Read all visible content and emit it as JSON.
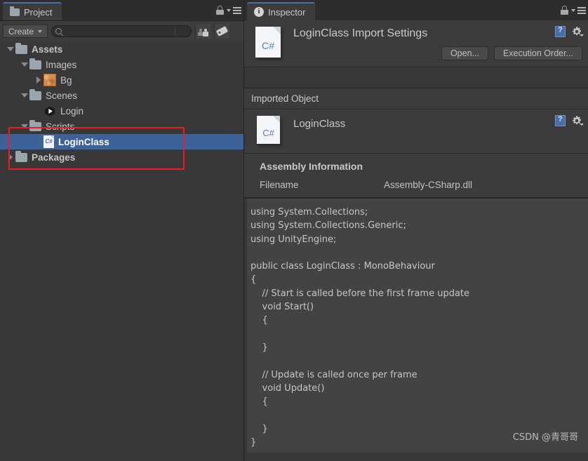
{
  "project_panel": {
    "tab": {
      "label": "Project",
      "icon": "folder-icon"
    },
    "tabbar_icons": {
      "lock": "lock-icon",
      "menu": "hamburger-menu-icon"
    },
    "toolbar": {
      "create_label": "Create",
      "search_value": "",
      "search_placeholder": "",
      "favorites_icon": "people-icon",
      "labels_icon": "label-tag-icon"
    },
    "tree": [
      {
        "label": "Assets",
        "indent": 0,
        "twisty": "down",
        "icon": "folder-icon",
        "bold": true,
        "selected": false
      },
      {
        "label": "Images",
        "indent": 1,
        "twisty": "down",
        "icon": "folder-icon",
        "bold": false,
        "selected": false
      },
      {
        "label": "Bg",
        "indent": 2,
        "twisty": "right",
        "icon": "texture-icon",
        "bold": false,
        "selected": false
      },
      {
        "label": "Scenes",
        "indent": 1,
        "twisty": "down",
        "icon": "folder-icon",
        "bold": false,
        "selected": false
      },
      {
        "label": "Login",
        "indent": 2,
        "twisty": "none",
        "icon": "unity-scene-icon",
        "bold": false,
        "selected": false
      },
      {
        "label": "Scripts",
        "indent": 1,
        "twisty": "down",
        "icon": "folder-icon",
        "bold": false,
        "selected": false
      },
      {
        "label": "LoginClass",
        "indent": 2,
        "twisty": "none",
        "icon": "csharp-file-icon",
        "bold": true,
        "selected": true
      },
      {
        "label": "Packages",
        "indent": 0,
        "twisty": "right",
        "icon": "folder-icon",
        "bold": true,
        "selected": false
      }
    ],
    "highlight_color": "#ed1c24",
    "selection_color": "#3d6199"
  },
  "inspector_panel": {
    "tab": {
      "label": "Inspector",
      "icon": "info-icon"
    },
    "tabbar_icons": {
      "lock": "lock-icon",
      "menu": "hamburger-menu-icon"
    },
    "import_header": {
      "title": "LoginClass Import Settings",
      "file_icon_label": "C#",
      "help_icon": "help-book-icon",
      "gear_icon": "gear-icon",
      "buttons": [
        {
          "label": "Open..."
        },
        {
          "label": "Execution Order..."
        }
      ]
    },
    "imported_object_section": {
      "header": "Imported Object",
      "object_name": "LoginClass",
      "file_icon_label": "C#",
      "help_icon": "help-book-icon",
      "gear_icon": "gear-icon"
    },
    "assembly_information": {
      "title": "Assembly Information",
      "rows": [
        {
          "key": "Filename",
          "value": "Assembly-CSharp.dll"
        }
      ]
    },
    "code_preview": "using System.Collections;\nusing System.Collections.Generic;\nusing UnityEngine;\n\npublic class LoginClass : MonoBehaviour\n{\n    // Start is called before the first frame update\n    void Start()\n    {\n        \n    }\n\n    // Update is called once per frame\n    void Update()\n    {\n        \n    }\n}"
  },
  "watermark": "CSDN @青哥哥"
}
